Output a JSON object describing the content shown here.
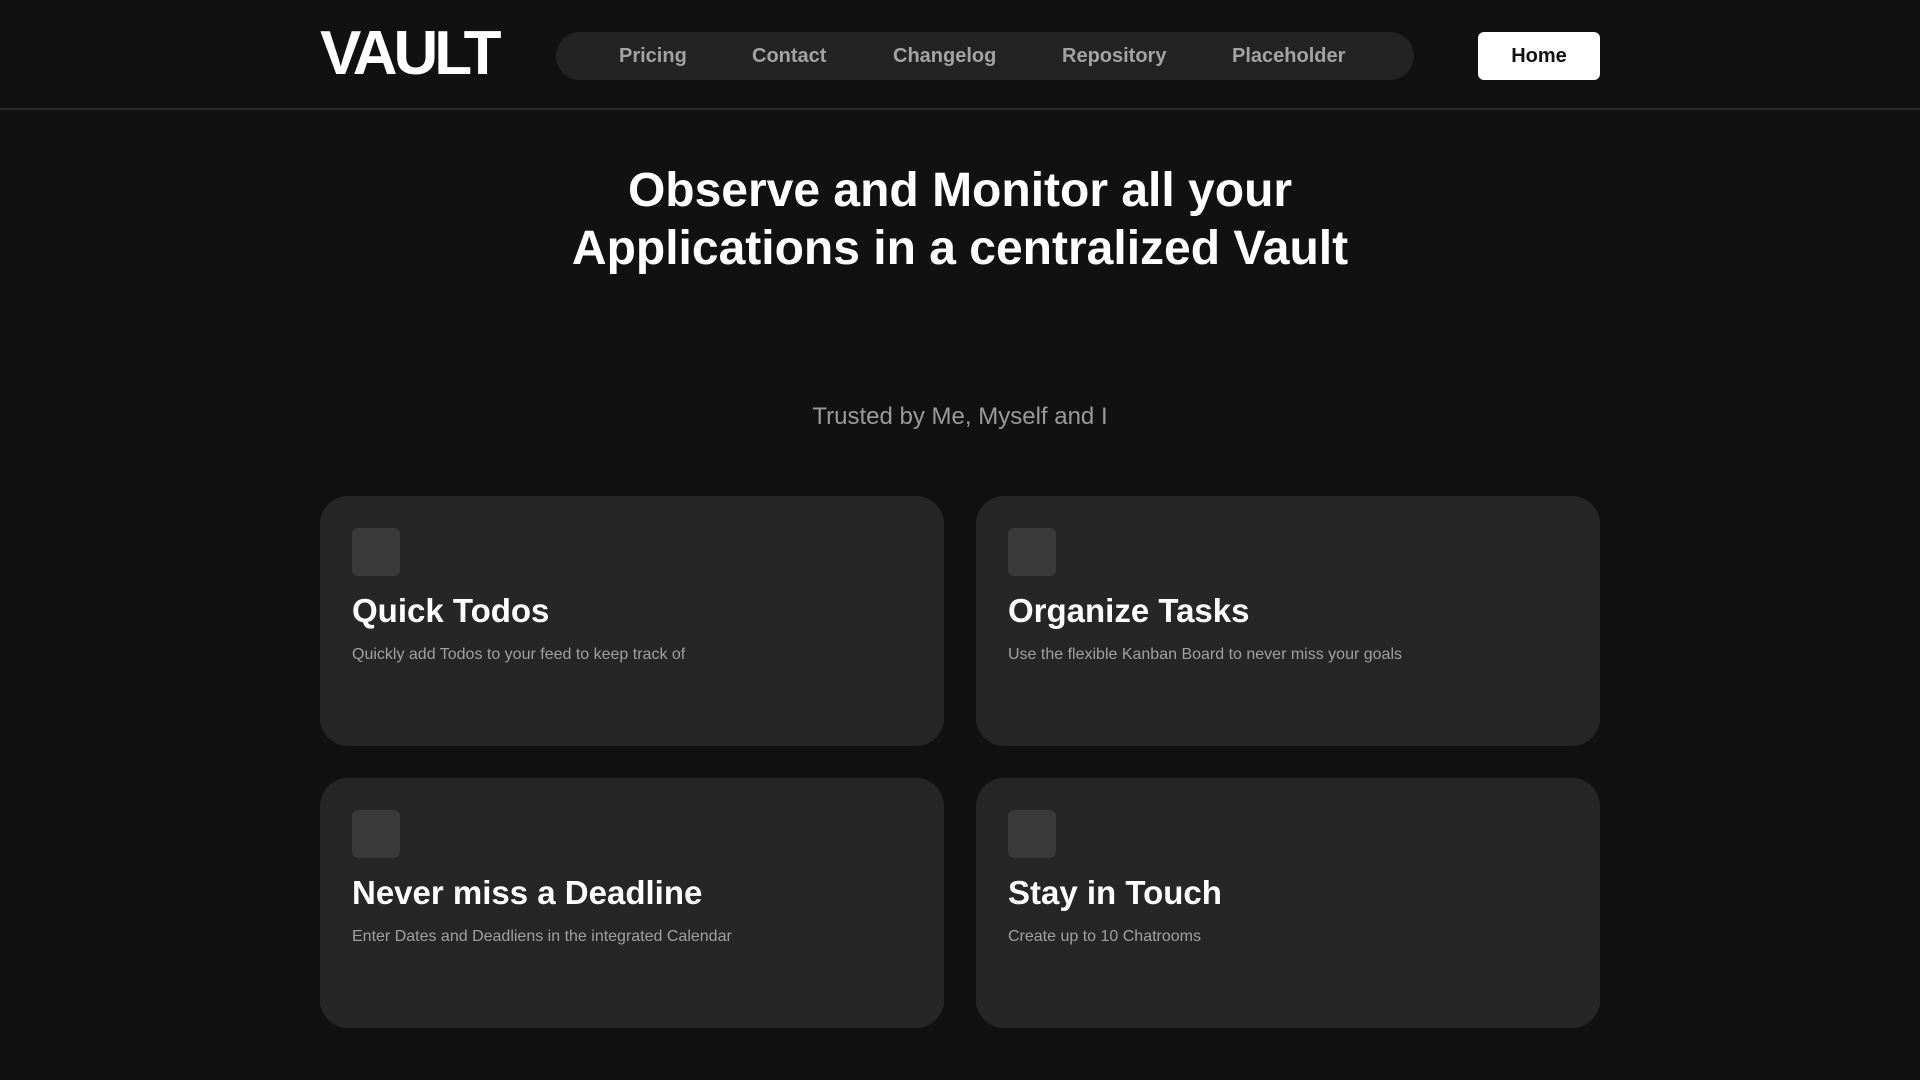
{
  "header": {
    "logo": "VAULT",
    "nav": [
      "Pricing",
      "Contact",
      "Changelog",
      "Repository",
      "Placeholder"
    ],
    "home_button": "Home"
  },
  "hero": {
    "title": "Observe and Monitor all your Applications in a centralized Vault",
    "subtitle": "Trusted by Me, Myself and I"
  },
  "features": [
    {
      "title": "Quick Todos",
      "description": "Quickly add Todos to your feed to keep track of",
      "icon": "placeholder-square-icon"
    },
    {
      "title": "Organize Tasks",
      "description": "Use the flexible Kanban Board to never miss your goals",
      "icon": "placeholder-square-icon"
    },
    {
      "title": "Never miss a Deadline",
      "description": "Enter Dates and Deadliens in the integrated Calendar",
      "icon": "placeholder-square-icon"
    },
    {
      "title": "Stay in Touch",
      "description": "Create up to 10 Chatrooms",
      "icon": "placeholder-square-icon"
    }
  ],
  "colors": {
    "background": "#111111",
    "nav_pill": "#232323",
    "card": "#262626",
    "card_icon": "#3a3a3a",
    "muted_text": "#a3a3a3",
    "accent_button": "#ffffff"
  }
}
